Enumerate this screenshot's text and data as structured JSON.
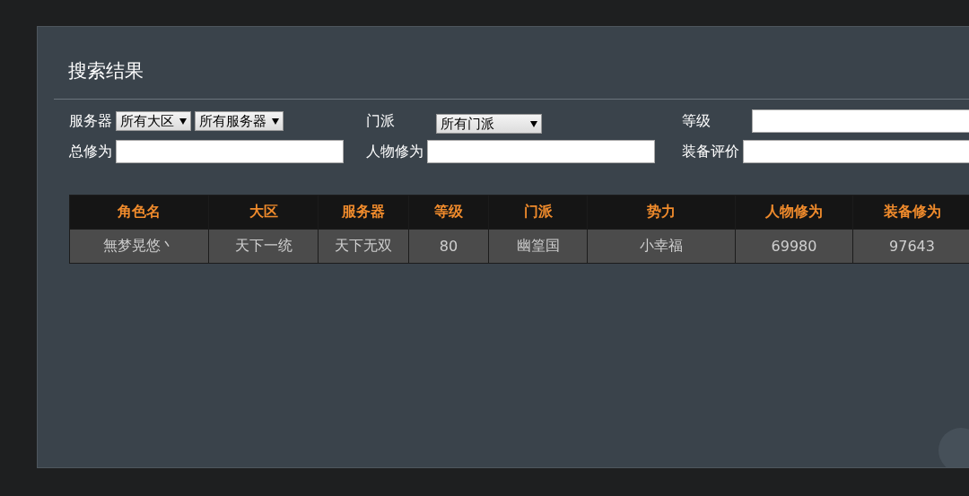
{
  "panel": {
    "title": "搜索结果"
  },
  "filters": [
    {
      "kind": "selects",
      "label": "服务器",
      "options": [
        "所有大区",
        "所有服务器"
      ]
    },
    {
      "kind": "select",
      "label": "门派",
      "value": "所有门派"
    },
    {
      "kind": "input",
      "label": "等级"
    },
    {
      "kind": "input",
      "label": "总修为"
    },
    {
      "kind": "input",
      "label": "人物修为"
    },
    {
      "kind": "input",
      "label": "装备评价"
    }
  ],
  "table": {
    "columns": [
      "角色名",
      "大区",
      "服务器",
      "等级",
      "门派",
      "势力",
      "人物修为",
      "装备修为"
    ],
    "rows": [
      [
        "無梦晃悠丶",
        "天下一统",
        "天下无双",
        "80",
        "幽篁国",
        "小幸福",
        "69980",
        "97643"
      ]
    ]
  }
}
